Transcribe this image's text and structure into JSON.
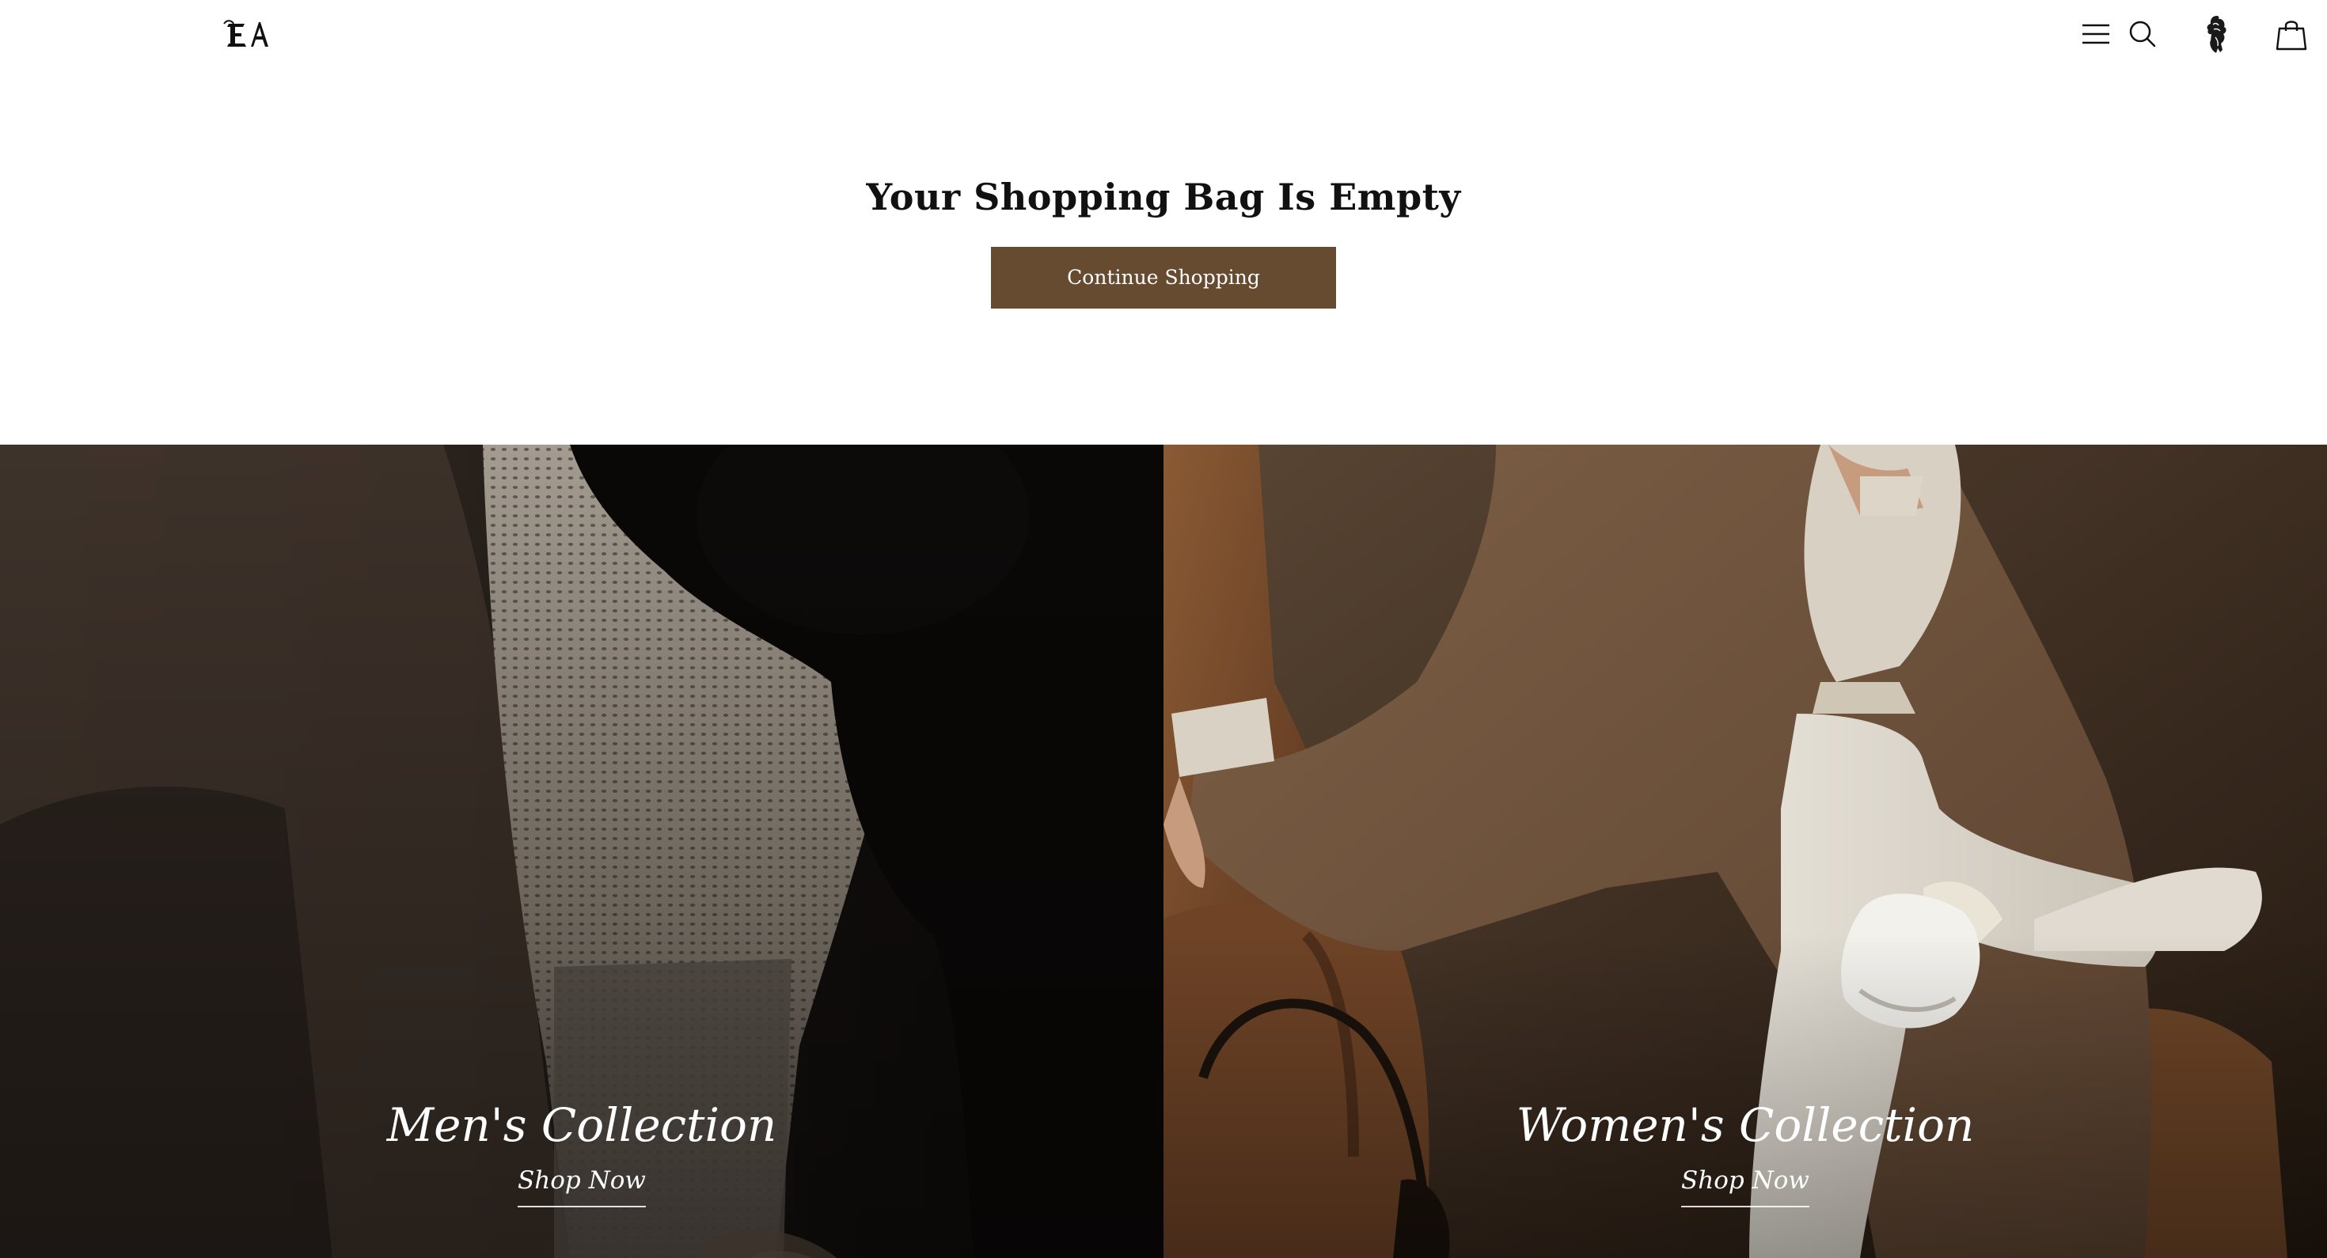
{
  "header": {
    "logo_alt": "EA",
    "icons": [
      "search-icon",
      "profile-figure-icon",
      "shopping-bag-icon",
      "menu-icon"
    ]
  },
  "empty_bag": {
    "title": "Your Shopping Bag Is Empty",
    "button_label": "Continue Shopping",
    "button_color": "#664b31"
  },
  "collections": [
    {
      "title": "Men's Collection",
      "link_label": "Shop Now"
    },
    {
      "title": "Women's Collection",
      "link_label": "Shop Now"
    }
  ],
  "colors": {
    "accent": "#664b31",
    "text": "#111111",
    "background": "#ffffff"
  }
}
